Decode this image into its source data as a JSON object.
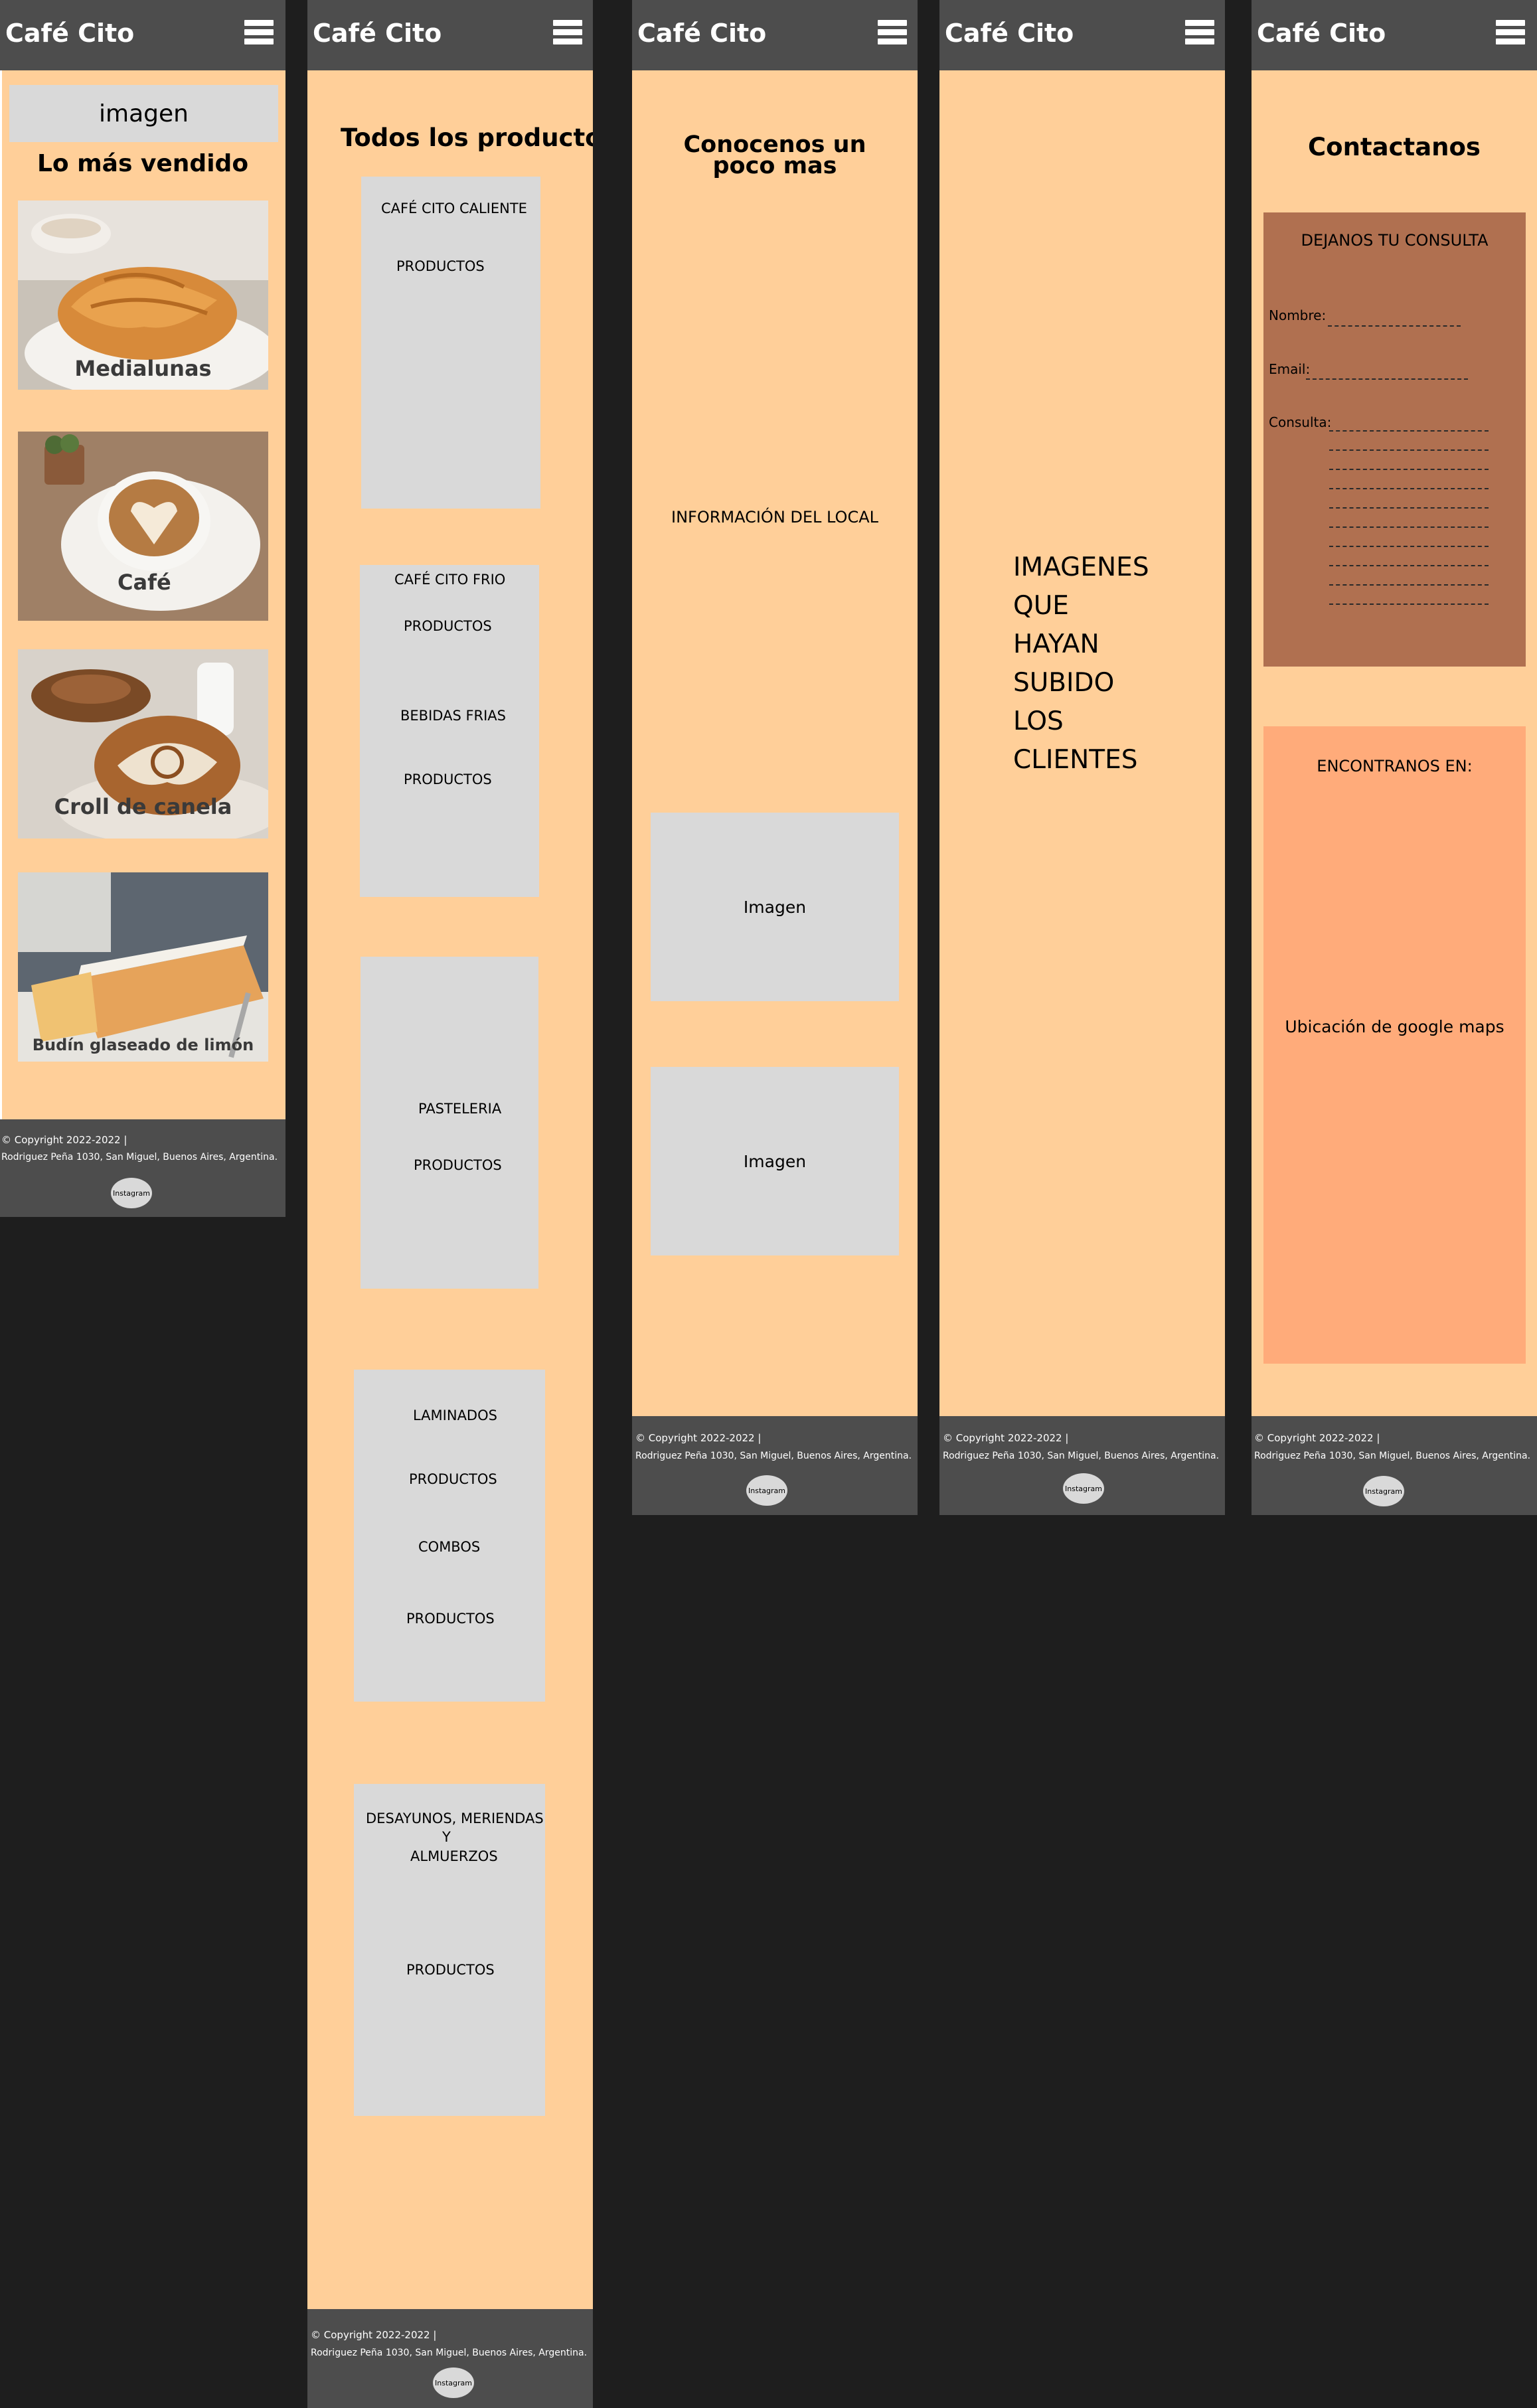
{
  "brand": "Café Cito",
  "footer": {
    "copyright": "© Copyright 2022-2022 |",
    "address": "Rodriguez Peña 1030, San Miguel, Buenos Aires, Argentina.",
    "instagram": "Instagram"
  },
  "home": {
    "banner": "imagen",
    "heading": "Lo más vendido",
    "products": [
      "Medialunas",
      "Café",
      "Croll de canela",
      "Budín glaseado de limón"
    ]
  },
  "products_page": {
    "heading": "Todos los productos",
    "cards": [
      {
        "lines": [
          "CAFÉ CITO CALIENTE",
          "PRODUCTOS"
        ]
      },
      {
        "lines": [
          "CAFÉ CITO FRIO",
          "PRODUCTOS",
          "BEBIDAS FRIAS",
          "PRODUCTOS"
        ]
      },
      {
        "lines": [
          "PASTELERIA",
          "PRODUCTOS"
        ]
      },
      {
        "lines": [
          "LAMINADOS",
          "PRODUCTOS",
          "COMBOS",
          "PRODUCTOS"
        ]
      },
      {
        "lines": [
          "DESAYUNOS, MERIENDAS",
          "Y",
          "ALMUERZOS",
          "PRODUCTOS"
        ]
      }
    ]
  },
  "about": {
    "heading_line1": "Conocenos un",
    "heading_line2": "poco mas",
    "info": "INFORMACIÓN DEL LOCAL",
    "image1": "Imagen",
    "image2": "Imagen"
  },
  "gallery": {
    "lines": [
      "IMAGENES",
      "QUE",
      "HAYAN",
      "SUBIDO",
      "LOS",
      "CLIENTES"
    ]
  },
  "contact": {
    "heading": "Contactanos",
    "form_title": "DEJANOS TU CONSULTA",
    "name_label": "Nombre:",
    "email_label": "Email:",
    "query_label": "Consulta:",
    "find_title": "ENCONTRANOS EN:",
    "map": "Ubicación de google maps"
  },
  "colors": {
    "page_bg": "#1e1e1e",
    "panel": "#ffcf99",
    "header": "#4d4d4d",
    "placeholder": "#d9d9d9",
    "form_box": "#b07050",
    "location_box": "#ffab7a"
  }
}
